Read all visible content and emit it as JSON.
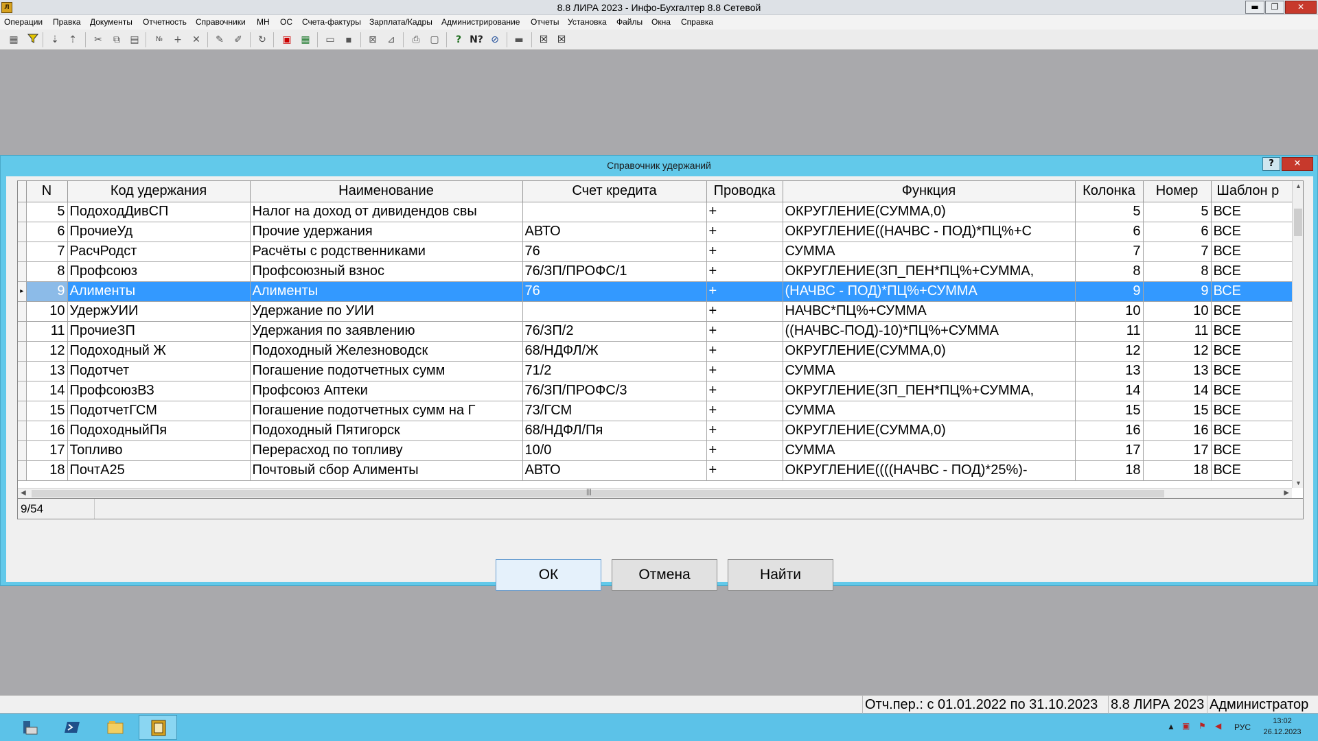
{
  "window": {
    "title": "8.8 ЛИРА 2023 - Инфо-Бухгалтер 8.8 Сетевой",
    "minimize_label": "▬",
    "restore_label": "❐",
    "close_label": "✕"
  },
  "menu": [
    "Операции",
    "Правка",
    "Документы",
    "Отчетность",
    "Справочники",
    "МН",
    "ОС",
    "Счета-фактуры",
    "Зарплата/Кадры",
    "Администрирование",
    "Отчеты",
    "Установка",
    "Файлы",
    "Окна",
    "Справка"
  ],
  "toolbar_icons": [
    "calculator-icon",
    "filter-icon",
    "sort-asc-icon",
    "sort-desc-icon",
    "cut-icon",
    "copy-format-icon",
    "paste-icon",
    "number-icon",
    "add-icon",
    "delete-icon",
    "pin-icon",
    "unpin-icon",
    "refresh-icon",
    "pdf-icon",
    "excel-icon",
    "open-folder-icon",
    "save-icon",
    "form-icon",
    "brush-icon",
    "print-icon",
    "preview-icon",
    "help-icon",
    "context-help-icon",
    "navigator-icon",
    "keyboard-icon",
    "close-window-icon",
    "close-all-icon"
  ],
  "dialog": {
    "title": "Справочник удержаний",
    "help_label": "?",
    "close_label": "✕"
  },
  "table": {
    "columns": [
      "N",
      "Код удержания",
      "Наименование",
      "Счет кредита",
      "Проводка",
      "Функция",
      "Колонка",
      "Номер",
      "Шаблон р"
    ],
    "rows": [
      {
        "n": "5",
        "code": "ПодоходДивСП",
        "name": "Налог на доход от дивидендов свы",
        "account": "",
        "posting": "+",
        "func": "ОКРУГЛЕНИЕ(СУММА,0)",
        "col": "5",
        "num": "5",
        "tpl": "ВСЕ"
      },
      {
        "n": "6",
        "code": "ПрочиеУд",
        "name": "Прочие удержания",
        "account": "АВТО",
        "posting": "+",
        "func": "ОКРУГЛЕНИЕ((НАЧВС - ПОД)*ПЦ%+С",
        "col": "6",
        "num": "6",
        "tpl": "ВСЕ"
      },
      {
        "n": "7",
        "code": "РасчРодст",
        "name": "Расчёты с родственниками",
        "account": "76",
        "posting": "+",
        "func": "СУММА",
        "col": "7",
        "num": "7",
        "tpl": "ВСЕ"
      },
      {
        "n": "8",
        "code": "Профсоюз",
        "name": "Профсоюзный взнос",
        "account": "76/ЗП/ПРОФС/1",
        "posting": "+",
        "func": "ОКРУГЛЕНИЕ(ЗП_ПЕН*ПЦ%+СУММА,",
        "col": "8",
        "num": "8",
        "tpl": "ВСЕ"
      },
      {
        "n": "9",
        "code": "Алименты",
        "name": "Алименты",
        "account": "76",
        "posting": "+",
        "func": "(НАЧВС - ПОД)*ПЦ%+СУММА",
        "col": "9",
        "num": "9",
        "tpl": "ВСЕ"
      },
      {
        "n": "10",
        "code": "УдержУИИ",
        "name": "Удержание по УИИ",
        "account": "",
        "posting": "+",
        "func": "НАЧВС*ПЦ%+СУММА",
        "col": "10",
        "num": "10",
        "tpl": "ВСЕ"
      },
      {
        "n": "11",
        "code": "ПрочиеЗП",
        "name": "Удержания по заявлению",
        "account": "76/ЗП/2",
        "posting": "+",
        "func": "((НАЧВС-ПОД)-10)*ПЦ%+СУММА",
        "col": "11",
        "num": "11",
        "tpl": "ВСЕ"
      },
      {
        "n": "12",
        "code": "Подоходный Ж",
        "name": "Подоходный Железноводск",
        "account": "68/НДФЛ/Ж",
        "posting": "+",
        "func": "ОКРУГЛЕНИЕ(СУММА,0)",
        "col": "12",
        "num": "12",
        "tpl": "ВСЕ"
      },
      {
        "n": "13",
        "code": "Подотчет",
        "name": "Погашение подотчетных сумм",
        "account": "71/2",
        "posting": "+",
        "func": "СУММА",
        "col": "13",
        "num": "13",
        "tpl": "ВСЕ"
      },
      {
        "n": "14",
        "code": "ПрофсоюзВЗ",
        "name": "Профсоюз Аптеки",
        "account": "76/ЗП/ПРОФС/3",
        "posting": "+",
        "func": "ОКРУГЛЕНИЕ(ЗП_ПЕН*ПЦ%+СУММА,",
        "col": "14",
        "num": "14",
        "tpl": "ВСЕ"
      },
      {
        "n": "15",
        "code": "ПодотчетГСМ",
        "name": "Погашение подотчетных сумм на Г",
        "account": "73/ГСМ",
        "posting": "+",
        "func": "СУММА",
        "col": "15",
        "num": "15",
        "tpl": "ВСЕ"
      },
      {
        "n": "16",
        "code": "ПодоходныйПя",
        "name": "Подоходный Пятигорск",
        "account": "68/НДФЛ/Пя",
        "posting": "+",
        "func": "ОКРУГЛЕНИЕ(СУММА,0)",
        "col": "16",
        "num": "16",
        "tpl": "ВСЕ"
      },
      {
        "n": "17",
        "code": "Топливо",
        "name": "Перерасход по топливу",
        "account": "10/0",
        "posting": "+",
        "func": "СУММА",
        "col": "17",
        "num": "17",
        "tpl": "ВСЕ"
      },
      {
        "n": "18",
        "code": "ПочтА25",
        "name": "Почтовый сбор Алименты",
        "account": "АВТО",
        "posting": "+",
        "func": "ОКРУГЛЕНИЕ((((НАЧВС - ПОД)*25%)-",
        "col": "18",
        "num": "18",
        "tpl": "ВСЕ"
      }
    ],
    "selected_row_indicator": "▸"
  },
  "counter": "9/54",
  "buttons": {
    "ok": "ОК",
    "cancel": "Отмена",
    "find": "Найти"
  },
  "statusbar": {
    "period": "Отч.пер.: с 01.01.2022 по 31.10.2023",
    "version": "8.8 ЛИРА 2023",
    "user": "Администратор"
  },
  "taskbar": {
    "language": "РУС",
    "time": "13:02",
    "date": "26.12.2023"
  },
  "colors": {
    "dialog_frame": "#62c9ea",
    "selection": "#3399ff",
    "taskbar": "#5cc2e8"
  }
}
